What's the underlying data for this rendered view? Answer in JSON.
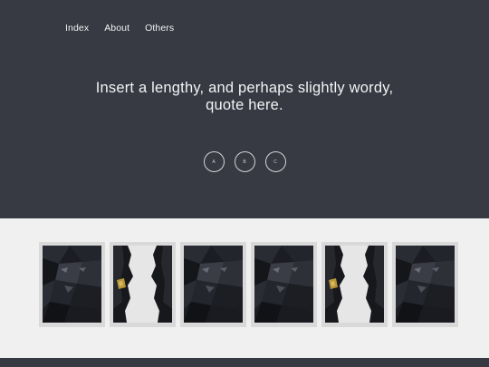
{
  "nav": {
    "items": [
      {
        "label": "Index"
      },
      {
        "label": "About"
      },
      {
        "label": "Others"
      }
    ]
  },
  "hero": {
    "quote_line1": "Insert a lengthy, and perhaps slightly wordy,",
    "quote_line2": "quote here.",
    "background": "#373943"
  },
  "circles": [
    {
      "label": "A"
    },
    {
      "label": "B"
    },
    {
      "label": "C"
    }
  ],
  "gallery": {
    "items": [
      {
        "kind": "face-front"
      },
      {
        "kind": "face-profile"
      },
      {
        "kind": "face-front"
      },
      {
        "kind": "face-front"
      },
      {
        "kind": "face-profile"
      },
      {
        "kind": "face-front"
      }
    ]
  },
  "colors": {
    "section_bg": "#f0f0f0",
    "thumb_frame": "#d9d9d9",
    "gold_accent": "#b8953a"
  }
}
